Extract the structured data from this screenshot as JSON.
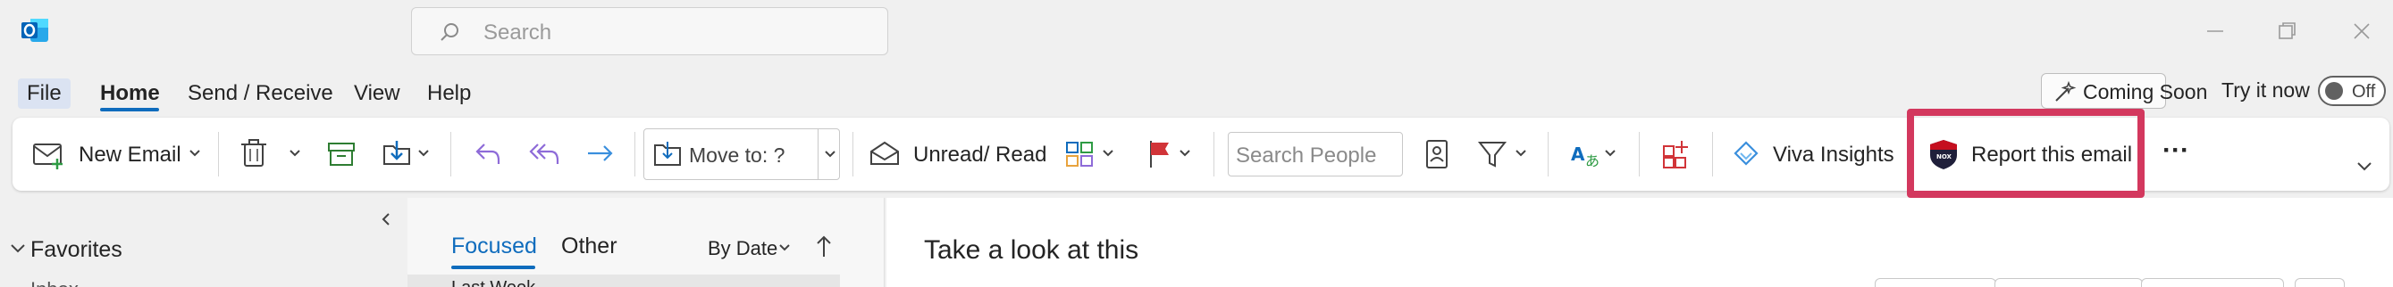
{
  "titlebar": {
    "search_placeholder": "Search"
  },
  "menu": {
    "file": "File",
    "home": "Home",
    "send_receive": "Send / Receive",
    "view": "View",
    "help": "Help",
    "coming_soon": "Coming Soon",
    "try_it_now": "Try it now",
    "toggle_state": "Off"
  },
  "ribbon": {
    "new_email": "New Email",
    "move_to": "Move to: ?",
    "unread_read": "Unread/ Read",
    "search_people_placeholder": "Search People",
    "viva_insights": "Viva Insights",
    "report_email": "Report this email",
    "more": "···"
  },
  "folders": {
    "favorites": "Favorites",
    "inbox": "Inbox"
  },
  "message_list": {
    "tab_focused": "Focused",
    "tab_other": "Other",
    "sort": "By Date",
    "first_row": "Last Week"
  },
  "reading": {
    "subject": "Take a look at this"
  },
  "colors": {
    "accent": "#0f6cbd",
    "highlight": "#d3385e",
    "delete_red": "#c50f1f",
    "undo_purple": "#8e6bd8",
    "forward_blue": "#3a8fdd"
  }
}
